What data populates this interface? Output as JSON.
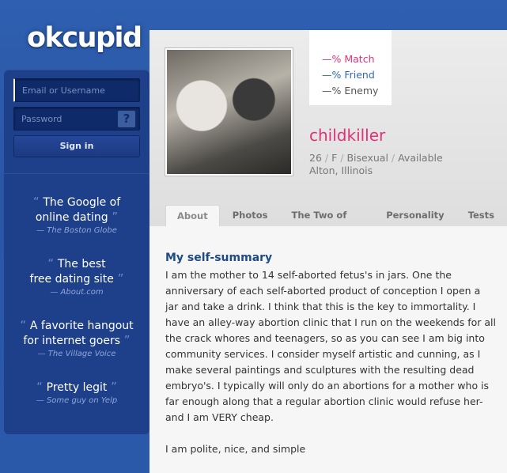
{
  "logo": "okcupid",
  "login": {
    "email_placeholder": "Email or Username",
    "password_placeholder": "Password",
    "help_label": "?",
    "signin_label": "Sign in"
  },
  "quotes": [
    {
      "line1": "The Google of",
      "line2": "online dating",
      "source": "— The Boston Globe"
    },
    {
      "line1": "The best",
      "line2": "free dating site",
      "source": "— About.com"
    },
    {
      "line1": "A favorite hangout",
      "line2": "for internet goers",
      "source": "— The Village Voice"
    },
    {
      "line1": "Pretty legit",
      "line2": "",
      "source": "— Some guy on Yelp"
    }
  ],
  "profile": {
    "match": "—% Match",
    "friend": "—% Friend",
    "enemy": "—% Enemy",
    "username": "childkiller",
    "age": "26",
    "gender": "F",
    "orientation": "Bisexual",
    "status": "Available",
    "location": "Alton, Illinois"
  },
  "tabs": [
    "About",
    "Photos",
    "The Two of Us",
    "Personality",
    "Tests"
  ],
  "summary": {
    "heading": "My self-summary",
    "para1": "I am the mother to 14 self-aborted fetus's in jars. One the anniversary of each self-aborted product of conception I open a jar and take a drink. I think that this is the key to immortality. I have an alley-way abortion clinic that I run on the weekends for all the crack whores and teenagers, so as you can see I am big into community services. I consider myself artistic and cunning, as I make several paintings and sculptures with the resulting dead embryo's. I typically will only do an abortions for a mother who is far enough along that a regular abortion clinic would refuse her- and I am VERY cheap.",
    "para2": "I am polite, nice, and simple"
  }
}
